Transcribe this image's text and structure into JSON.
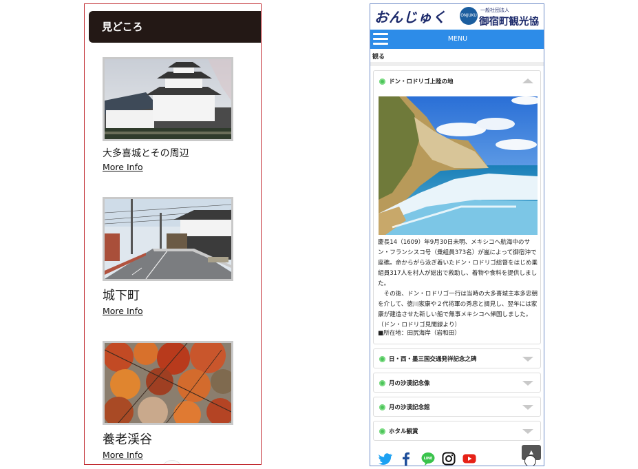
{
  "left": {
    "header_title": "見どころ",
    "spots": [
      {
        "title": "大多喜城とその周辺",
        "link": "More Info"
      },
      {
        "title": "城下町",
        "link": "More Info"
      },
      {
        "title": "養老渓谷",
        "link": "More Info"
      }
    ]
  },
  "right": {
    "brand": "おんじゅく",
    "emblem_text": "ONJUKU",
    "assoc_small": "一般社団法人",
    "assoc_name": "御宿町観光協会",
    "menu_label": "MENU",
    "section_label": "観る",
    "open_item": {
      "title": "ドン・ロドリゴ上陸の地",
      "paragraphs": [
        "慶長14（1609）年9月30日未明、メキシコへ航海中のサン・フランシスコ号（乗組員373名）が嵐によって御宿沖で座礁。命からがら泳ぎ着いたドン・ロドリゴ総督をはじめ乗組員317人を村人が総出で救助し、着物や食料を提供しました。",
        "　その後、ドン・ロドリゴ一行は当時の大多喜城主本多忠朝を介して、徳川家康や２代将軍の秀忠と謁見し、翌年には家康が建造させた新しい船で無事メキシコへ帰国しました。（ドン・ロドリゴ見聞録より）"
      ],
      "location": "■所在地：田尻海岸（岩和田）"
    },
    "collapsed_items": [
      "日・西・墨三国交通発祥記念之碑",
      "月の沙漠記念像",
      "月の沙漠記念館",
      "ホタル観賞"
    ],
    "social": [
      "twitter-icon",
      "facebook-icon",
      "line-icon",
      "instagram-icon",
      "youtube-icon"
    ],
    "line_text": "LINE",
    "back_to_top": "▲"
  },
  "colors": {
    "left_border": "#c0262c",
    "left_header_bg": "#231815",
    "menu_bar": "#2d8ce8",
    "brand_navy": "#1c2a6b",
    "accordion_dot": "#4cc35a"
  }
}
